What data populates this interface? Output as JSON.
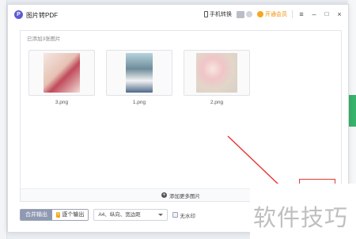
{
  "window": {
    "title": "图片转PDF",
    "logo_letter": "P",
    "phone_convert": "手机转换",
    "vip": "开通会员",
    "menu_icon": "≡",
    "min_icon": "–",
    "max_icon": "□",
    "close_icon": "×"
  },
  "content": {
    "added_label": "已添加3张图片",
    "images": [
      {
        "name": "3.png"
      },
      {
        "name": "1.png"
      },
      {
        "name": "2.png"
      }
    ],
    "add_more": "添加更多图片"
  },
  "controls": {
    "merge": "合并输出",
    "each": "逐个输出",
    "each_tag": "V",
    "page_setting": "A4、纵向、宽边距",
    "no_watermark": "无水印"
  },
  "watermark": "软件技巧",
  "colors": {
    "accent": "#5b5bd6",
    "vip": "#f08c00",
    "annotation": "#e53935"
  }
}
